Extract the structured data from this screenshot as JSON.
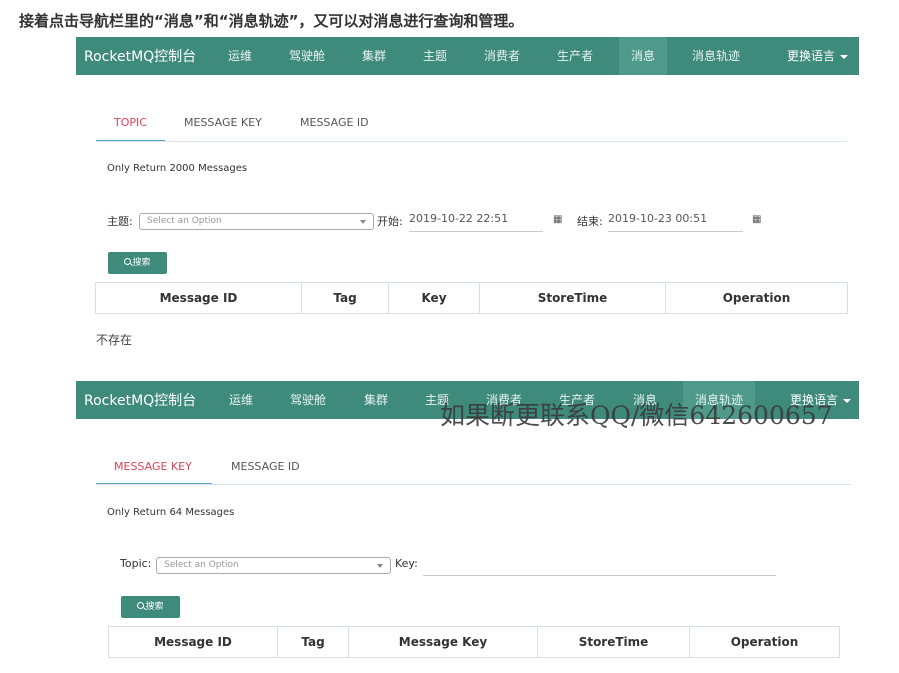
{
  "caption": "接着点击导航栏里的“消息”和“消息轨迹”，又可以对消息进行查询和管理。",
  "nav": {
    "brand": "RocketMQ控制台",
    "items": [
      "运维",
      "驾驶舱",
      "集群",
      "主题",
      "消费者",
      "生产者",
      "消息",
      "消息轨迹"
    ],
    "language": "更换语言"
  },
  "panel1": {
    "tabs": [
      "TOPIC",
      "MESSAGE KEY",
      "MESSAGE ID"
    ],
    "info": "Only Return 2000 Messages",
    "topic_label": "主题:",
    "select_placeholder": "Select an Option",
    "start_label": "开始:",
    "start_value": "2019-10-22 22:51",
    "end_label": "结束:",
    "end_value": "2019-10-23 00:51",
    "search_button": "搜索",
    "columns": [
      "Message ID",
      "Tag",
      "Key",
      "StoreTime",
      "Operation"
    ],
    "empty_text": "不存在"
  },
  "panel2": {
    "tabs": [
      "MESSAGE KEY",
      "MESSAGE ID"
    ],
    "info": "Only Return 64 Messages",
    "topic_label": "Topic:",
    "select_placeholder": "Select an Option",
    "key_label": "Key:",
    "search_button": "搜索",
    "columns": [
      "Message ID",
      "Tag",
      "Message Key",
      "StoreTime",
      "Operation"
    ]
  },
  "watermark": "如果断更联系QQ/微信642600657",
  "colors": {
    "navbar": "#3f8b7b",
    "active_tab": "#d8445b",
    "tab_underline": "#59a9c8",
    "button": "#3f8b7b"
  }
}
